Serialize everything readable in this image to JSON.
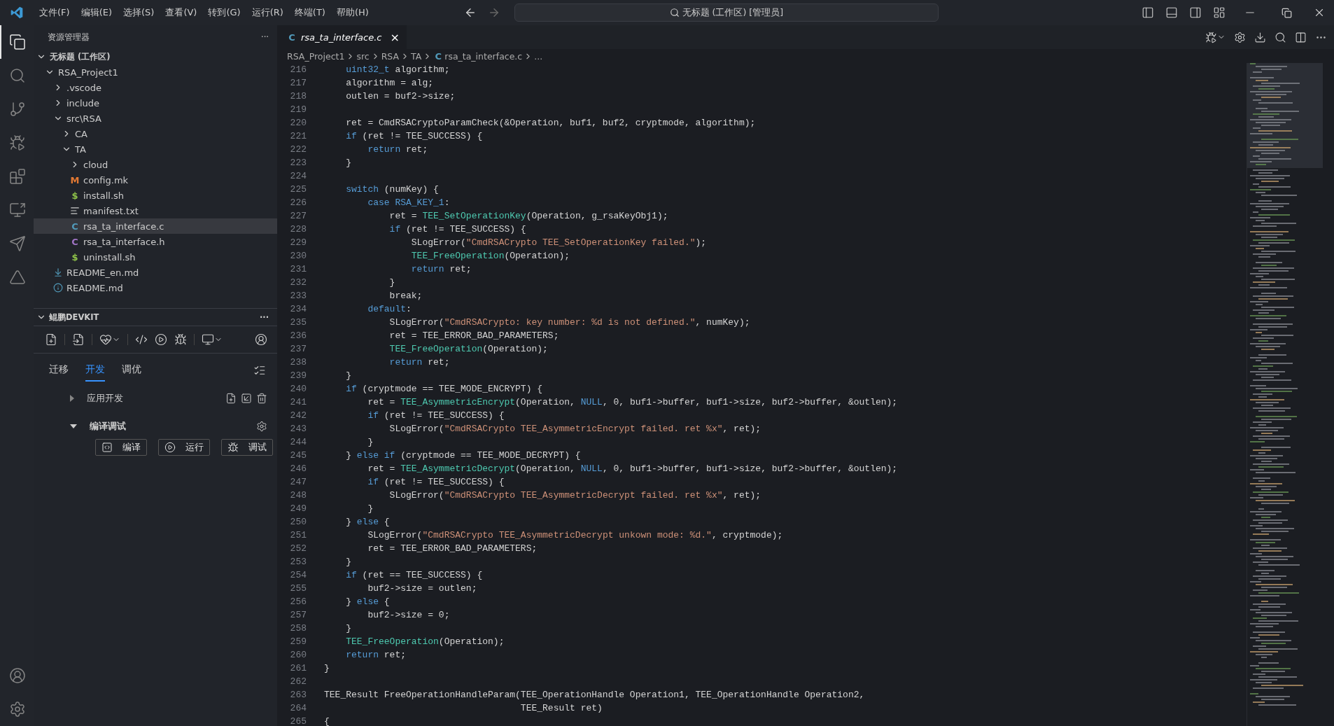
{
  "title_bar": {
    "menus": [
      "文件(F)",
      "编辑(E)",
      "选择(S)",
      "查看(V)",
      "转到(G)",
      "运行(R)",
      "终端(T)",
      "帮助(H)"
    ],
    "command_center": "无标题 (工作区) [管理员]"
  },
  "activity_bar": {
    "items": [
      {
        "kind": "files",
        "selected": true
      },
      {
        "kind": "search",
        "selected": false
      },
      {
        "kind": "source-control",
        "selected": false
      },
      {
        "kind": "run-debug",
        "selected": false
      },
      {
        "kind": "extensions",
        "selected": false
      },
      {
        "kind": "remote",
        "selected": false
      },
      {
        "kind": "send",
        "selected": false
      },
      {
        "kind": "tool",
        "selected": false
      }
    ]
  },
  "explorer": {
    "title": "资源管理器",
    "more": "···",
    "workspace": {
      "label": "无标题 (工作区)",
      "expanded": true
    },
    "tree": [
      {
        "kind": "folder",
        "label": "RSA_Project1",
        "expanded": true,
        "selected": false,
        "children": [
          {
            "kind": "folder",
            "label": ".vscode",
            "expanded": false,
            "selected": false
          },
          {
            "kind": "folder",
            "label": "include",
            "expanded": false,
            "selected": false
          },
          {
            "kind": "folder",
            "label": "src\\RSA",
            "expanded": true,
            "selected": false,
            "children": [
              {
                "kind": "folder",
                "label": "CA",
                "expanded": false,
                "selected": false
              },
              {
                "kind": "folder",
                "label": "TA",
                "expanded": true,
                "selected": false,
                "children": [
                  {
                    "kind": "folder",
                    "label": "cloud",
                    "expanded": false,
                    "selected": false
                  },
                  {
                    "kind": "letter",
                    "glyph": "M",
                    "color": "#e37933",
                    "label": "config.mk",
                    "selected": false
                  },
                  {
                    "kind": "letter",
                    "glyph": "$",
                    "color": "#8dc149",
                    "label": "install.sh",
                    "selected": false
                  },
                  {
                    "kind": "lines",
                    "label": "manifest.txt",
                    "selected": false
                  },
                  {
                    "kind": "letter",
                    "glyph": "C",
                    "color": "#519aba",
                    "label": "rsa_ta_interface.c",
                    "selected": true
                  },
                  {
                    "kind": "letter",
                    "glyph": "C",
                    "color": "#a074c4",
                    "label": "rsa_ta_interface.h",
                    "selected": false
                  },
                  {
                    "kind": "letter",
                    "glyph": "$",
                    "color": "#8dc149",
                    "label": "uninstall.sh",
                    "selected": false
                  }
                ]
              }
            ]
          },
          {
            "kind": "download",
            "label": "README_en.md",
            "selected": false
          },
          {
            "kind": "info",
            "label": "README.md",
            "selected": false
          }
        ]
      }
    ]
  },
  "devkit": {
    "title": "鲲鹏DEVKIT",
    "more": "···",
    "expanded": true,
    "tabs": [
      {
        "label": "迁移",
        "selected": false
      },
      {
        "label": "开发",
        "selected": true
      },
      {
        "label": "调优",
        "selected": false
      }
    ],
    "sections": [
      {
        "label": "应用开发",
        "expanded": false
      },
      {
        "label": "编译调试",
        "expanded": true
      }
    ],
    "buttons": [
      {
        "kind": "build",
        "label": "编译"
      },
      {
        "kind": "run",
        "label": "运行"
      },
      {
        "kind": "debug",
        "label": "调试"
      }
    ]
  },
  "editor": {
    "tab": {
      "glyph": "C",
      "label": "rsa_ta_interface.c",
      "close": "×"
    },
    "breadcrumbs": [
      {
        "label": "RSA_Project1"
      },
      {
        "label": "src"
      },
      {
        "label": "RSA"
      },
      {
        "label": "TA"
      },
      {
        "glyph": "C",
        "label": "rsa_ta_interface.c"
      },
      {
        "label": "..."
      }
    ],
    "lines": [
      {
        "number": "216",
        "tokens": [
          {
            "kind": "kw",
            "text": "    uint32_t"
          },
          {
            "kind": "plain",
            "text": " algorithm;"
          }
        ]
      },
      {
        "number": "217",
        "tokens": [
          {
            "kind": "plain",
            "text": "    algorithm = alg;"
          }
        ]
      },
      {
        "number": "218",
        "tokens": [
          {
            "kind": "plain",
            "text": "    outlen = buf2->size;"
          }
        ]
      },
      {
        "number": "219"
      },
      {
        "number": "220",
        "tokens": [
          {
            "kind": "plain",
            "text": "    ret = CmdRSACryptoParamCheck(&Operation, buf1, buf2, cryptmode, algorithm);"
          }
        ]
      },
      {
        "number": "221",
        "tokens": [
          {
            "kind": "kw",
            "text": "    if"
          },
          {
            "kind": "plain",
            "text": " (ret != TEE_SUCCESS) {"
          }
        ]
      },
      {
        "number": "222",
        "tokens": [
          {
            "kind": "kw",
            "text": "        return"
          },
          {
            "kind": "plain",
            "text": " ret;"
          }
        ]
      },
      {
        "number": "223",
        "tokens": [
          {
            "kind": "plain",
            "text": "    }"
          }
        ]
      },
      {
        "number": "224"
      },
      {
        "number": "225",
        "tokens": [
          {
            "kind": "kw",
            "text": "    switch"
          },
          {
            "kind": "plain",
            "text": " (numKey) {"
          }
        ]
      },
      {
        "number": "226",
        "tokens": [
          {
            "kind": "kw",
            "text": "        case RSA_KEY_1"
          },
          {
            "kind": "plain",
            "text": ":"
          }
        ]
      },
      {
        "number": "227",
        "tokens": [
          {
            "kind": "plain",
            "text": "            ret = "
          },
          {
            "kind": "fn",
            "text": "TEE_SetOperationKey"
          },
          {
            "kind": "plain",
            "text": "(Operation, g_rsaKeyObj1);"
          }
        ]
      },
      {
        "number": "228",
        "tokens": [
          {
            "kind": "kw",
            "text": "            if"
          },
          {
            "kind": "plain",
            "text": " (ret != TEE_SUCCESS) {"
          }
        ]
      },
      {
        "number": "229",
        "tokens": [
          {
            "kind": "plain",
            "text": "                SLogError("
          },
          {
            "kind": "str",
            "text": "\"CmdRSACrypto TEE_SetOperationKey failed.\""
          },
          {
            "kind": "plain",
            "text": ");"
          }
        ]
      },
      {
        "number": "230",
        "tokens": [
          {
            "kind": "fn",
            "text": "                TEE_FreeOperation"
          },
          {
            "kind": "plain",
            "text": "(Operation);"
          }
        ]
      },
      {
        "number": "231",
        "tokens": [
          {
            "kind": "kw",
            "text": "                return"
          },
          {
            "kind": "plain",
            "text": " ret;"
          }
        ]
      },
      {
        "number": "232",
        "tokens": [
          {
            "kind": "plain",
            "text": "            }"
          }
        ]
      },
      {
        "number": "233",
        "tokens": [
          {
            "kind": "plain",
            "text": "            break;"
          }
        ]
      },
      {
        "number": "234",
        "tokens": [
          {
            "kind": "kw",
            "text": "        default"
          },
          {
            "kind": "plain",
            "text": ":"
          }
        ]
      },
      {
        "number": "235",
        "tokens": [
          {
            "kind": "plain",
            "text": "            SLogError("
          },
          {
            "kind": "str",
            "text": "\"CmdRSACrypto: key number: %d is not defined.\""
          },
          {
            "kind": "plain",
            "text": ", numKey);"
          }
        ]
      },
      {
        "number": "236",
        "tokens": [
          {
            "kind": "plain",
            "text": "            ret = TEE_ERROR_BAD_PARAMETERS;"
          }
        ]
      },
      {
        "number": "237",
        "tokens": [
          {
            "kind": "fn",
            "text": "            TEE_FreeOperation"
          },
          {
            "kind": "plain",
            "text": "(Operation);"
          }
        ]
      },
      {
        "number": "238",
        "tokens": [
          {
            "kind": "kw",
            "text": "            return"
          },
          {
            "kind": "plain",
            "text": " ret;"
          }
        ]
      },
      {
        "number": "239",
        "tokens": [
          {
            "kind": "plain",
            "text": "    }"
          }
        ]
      },
      {
        "number": "240",
        "tokens": [
          {
            "kind": "kw",
            "text": "    if"
          },
          {
            "kind": "plain",
            "text": " (cryptmode == TEE_MODE_ENCRYPT) {"
          }
        ]
      },
      {
        "number": "241",
        "tokens": [
          {
            "kind": "plain",
            "text": "        ret = "
          },
          {
            "kind": "fn",
            "text": "TEE_AsymmetricEncrypt"
          },
          {
            "kind": "plain",
            "text": "(Operation, "
          },
          {
            "kind": "kw",
            "text": "NULL"
          },
          {
            "kind": "plain",
            "text": ", 0, buf1->buffer, buf1->size, buf2->buffer, &outlen);"
          }
        ]
      },
      {
        "number": "242",
        "tokens": [
          {
            "kind": "kw",
            "text": "        if"
          },
          {
            "kind": "plain",
            "text": " (ret != TEE_SUCCESS) {"
          }
        ]
      },
      {
        "number": "243",
        "tokens": [
          {
            "kind": "plain",
            "text": "            SLogError("
          },
          {
            "kind": "str",
            "text": "\"CmdRSACrypto TEE_AsymmetricEncrypt failed. ret %x\""
          },
          {
            "kind": "plain",
            "text": ", ret);"
          }
        ]
      },
      {
        "number": "244",
        "tokens": [
          {
            "kind": "plain",
            "text": "        }"
          }
        ]
      },
      {
        "number": "245",
        "tokens": [
          {
            "kind": "plain",
            "text": "    } "
          },
          {
            "kind": "kw",
            "text": "else if"
          },
          {
            "kind": "plain",
            "text": " (cryptmode == TEE_MODE_DECRYPT) {"
          }
        ]
      },
      {
        "number": "246",
        "tokens": [
          {
            "kind": "plain",
            "text": "        ret = "
          },
          {
            "kind": "fn",
            "text": "TEE_AsymmetricDecrypt"
          },
          {
            "kind": "plain",
            "text": "(Operation, "
          },
          {
            "kind": "kw",
            "text": "NULL"
          },
          {
            "kind": "plain",
            "text": ", 0, buf1->buffer, buf1->size, buf2->buffer, &outlen);"
          }
        ]
      },
      {
        "number": "247",
        "tokens": [
          {
            "kind": "kw",
            "text": "        if"
          },
          {
            "kind": "plain",
            "text": " (ret != TEE_SUCCESS) {"
          }
        ]
      },
      {
        "number": "248",
        "tokens": [
          {
            "kind": "plain",
            "text": "            SLogError("
          },
          {
            "kind": "str",
            "text": "\"CmdRSACrypto TEE_AsymmetricDecrypt failed. ret %x\""
          },
          {
            "kind": "plain",
            "text": ", ret);"
          }
        ]
      },
      {
        "number": "249",
        "tokens": [
          {
            "kind": "plain",
            "text": "        }"
          }
        ]
      },
      {
        "number": "250",
        "tokens": [
          {
            "kind": "plain",
            "text": "    } "
          },
          {
            "kind": "kw",
            "text": "else"
          },
          {
            "kind": "plain",
            "text": " {"
          }
        ]
      },
      {
        "number": "251",
        "tokens": [
          {
            "kind": "plain",
            "text": "        SLogError("
          },
          {
            "kind": "str",
            "text": "\"CmdRSACrypto TEE_AsymmetricDecrypt unkown mode: %d.\""
          },
          {
            "kind": "plain",
            "text": ", cryptmode);"
          }
        ]
      },
      {
        "number": "252",
        "tokens": [
          {
            "kind": "plain",
            "text": "        ret = TEE_ERROR_BAD_PARAMETERS;"
          }
        ]
      },
      {
        "number": "253",
        "tokens": [
          {
            "kind": "plain",
            "text": "    }"
          }
        ]
      },
      {
        "number": "254",
        "tokens": [
          {
            "kind": "kw",
            "text": "    if"
          },
          {
            "kind": "plain",
            "text": " (ret == TEE_SUCCESS) {"
          }
        ]
      },
      {
        "number": "255",
        "tokens": [
          {
            "kind": "plain",
            "text": "        buf2->size = outlen;"
          }
        ]
      },
      {
        "number": "256",
        "tokens": [
          {
            "kind": "plain",
            "text": "    } "
          },
          {
            "kind": "kw",
            "text": "else"
          },
          {
            "kind": "plain",
            "text": " {"
          }
        ]
      },
      {
        "number": "257",
        "tokens": [
          {
            "kind": "plain",
            "text": "        buf2->size = 0;"
          }
        ]
      },
      {
        "number": "258",
        "tokens": [
          {
            "kind": "plain",
            "text": "    }"
          }
        ]
      },
      {
        "number": "259",
        "tokens": [
          {
            "kind": "fn",
            "text": "    TEE_FreeOperation"
          },
          {
            "kind": "plain",
            "text": "(Operation);"
          }
        ]
      },
      {
        "number": "260",
        "tokens": [
          {
            "kind": "kw",
            "text": "    return"
          },
          {
            "kind": "plain",
            "text": " ret;"
          }
        ]
      },
      {
        "number": "261",
        "tokens": [
          {
            "kind": "plain",
            "text": "}"
          }
        ]
      },
      {
        "number": "262"
      },
      {
        "number": "263",
        "tokens": [
          {
            "kind": "plain",
            "text": "TEE_Result FreeOperationHandleParam(TEE_OperationHandle Operation1, TEE_OperationHandle Operation2,"
          }
        ]
      },
      {
        "number": "264",
        "tokens": [
          {
            "kind": "plain",
            "text": "                                    TEE_Result ret)"
          }
        ]
      },
      {
        "number": "265",
        "tokens": [
          {
            "kind": "plain",
            "text": "{"
          }
        ]
      }
    ]
  }
}
